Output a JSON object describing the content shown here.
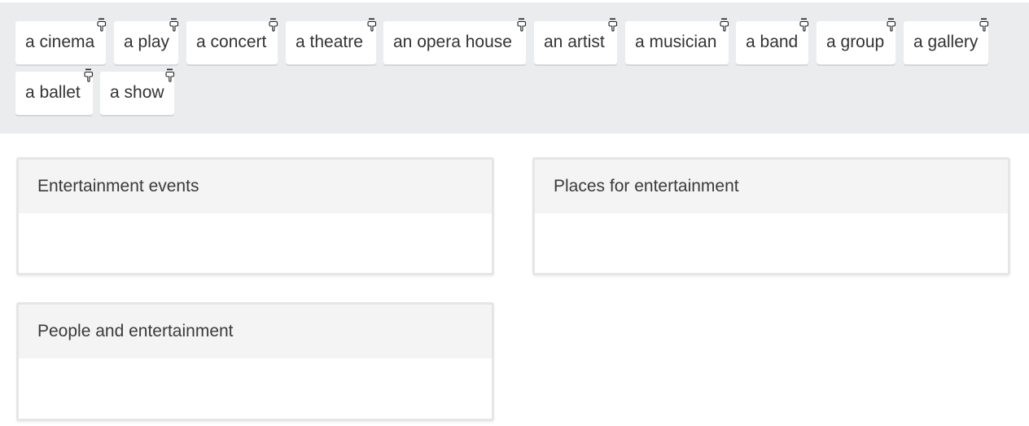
{
  "word_bank": {
    "chips": [
      {
        "label": "a cinema",
        "icon": "drag-hand-icon"
      },
      {
        "label": "a play",
        "icon": "drag-hand-icon"
      },
      {
        "label": "a concert",
        "icon": "drag-hand-icon"
      },
      {
        "label": "a theatre",
        "icon": "drag-hand-icon"
      },
      {
        "label": "an opera house",
        "icon": "drag-hand-icon"
      },
      {
        "label": "an artist",
        "icon": "drag-hand-icon"
      },
      {
        "label": "a musician",
        "icon": "drag-hand-icon"
      },
      {
        "label": "a band",
        "icon": "drag-hand-icon"
      },
      {
        "label": "a group",
        "icon": "drag-hand-icon"
      },
      {
        "label": "a gallery",
        "icon": "drag-hand-icon"
      },
      {
        "label": "a ballet",
        "icon": "drag-hand-icon"
      },
      {
        "label": "a show",
        "icon": "drag-hand-icon"
      }
    ]
  },
  "drop_zones": [
    {
      "title": "Entertainment events"
    },
    {
      "title": "Places for entertainment"
    },
    {
      "title": "People and entertainment"
    }
  ],
  "colors": {
    "word_bank_background": "#eaeced",
    "chip_background": "#ffffff",
    "zone_header_background": "#f4f4f4",
    "zone_border": "#e6e6e6",
    "text": "#333333"
  }
}
